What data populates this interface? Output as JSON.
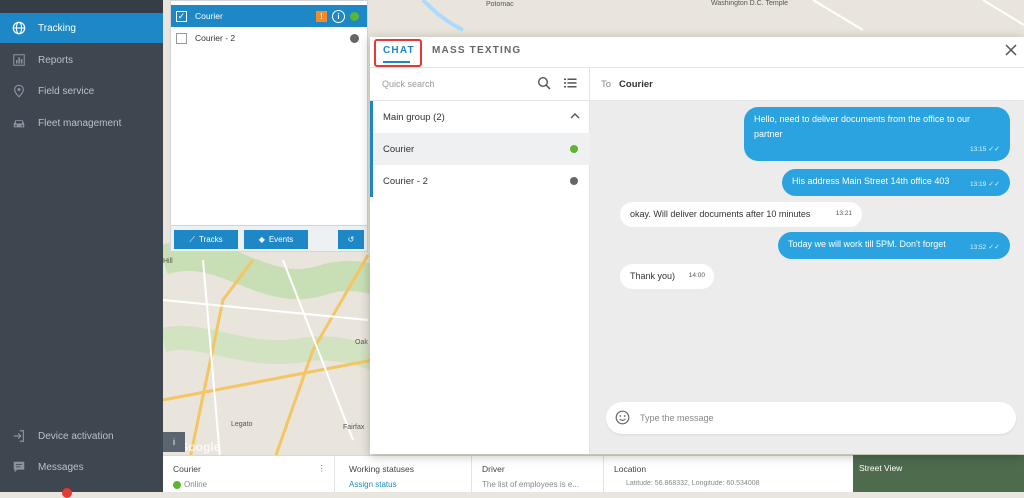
{
  "nav": {
    "items": [
      {
        "label": "Tracking",
        "icon": "globe-icon"
      },
      {
        "label": "Reports",
        "icon": "bar-chart-icon"
      },
      {
        "label": "Field service",
        "icon": "location-pin-icon"
      },
      {
        "label": "Fleet management",
        "icon": "car-icon"
      }
    ],
    "bottom_items": [
      {
        "label": "Device activation",
        "icon": "login-icon"
      },
      {
        "label": "Messages",
        "icon": "chat-bubble-icon"
      }
    ]
  },
  "units": {
    "rows": [
      {
        "name": "Courier",
        "status_color": "#5ab72e",
        "checked": true
      },
      {
        "name": "Courier - 2",
        "status_color": "#666666",
        "checked": false
      }
    ],
    "tracks_label": "Tracks",
    "events_label": "Events"
  },
  "bottombar": {
    "unit_name": "Courier",
    "unit_status": "Online",
    "working_statuses_label": "Working statuses",
    "assign_status_link": "Assign status",
    "driver_label": "Driver",
    "driver_value": "The list of employees is e...",
    "location_label": "Location",
    "location_value": "Latitude: 56.868332, Longitude: 60.534008",
    "street_view_label": "Street View",
    "info_btn": "i"
  },
  "map": {
    "labels": [
      "Potomac",
      "Washington D.C. Temple",
      "Hill",
      "Legato",
      "Fairfax",
      "Oak"
    ]
  },
  "chat": {
    "tabs": {
      "chat": "CHAT",
      "mass_texting": "MASS TEXTING"
    },
    "search_placeholder": "Quick search",
    "group_label": "Main group (2)",
    "contacts": [
      {
        "name": "Courier",
        "status_color": "#5ab72e"
      },
      {
        "name": "Courier - 2",
        "status_color": "#666666"
      }
    ],
    "to_label": "To",
    "to_name": "Courier",
    "messages": [
      {
        "direction": "out",
        "text_line1": "Hello, need to deliver documents from the office to our",
        "text_line2": "partner",
        "time": "13:15"
      },
      {
        "direction": "out",
        "text": "His address Main Street 14th office 403",
        "time": "13:19"
      },
      {
        "direction": "in",
        "text": "okay. Will deliver documents after 10 minutes",
        "time": "13:21"
      },
      {
        "direction": "out",
        "text": "Today we will work till 5PM. Don't forget",
        "time": "13:52"
      },
      {
        "direction": "in",
        "text": "Thank you)",
        "time": "14:00"
      }
    ],
    "input_placeholder": "Type the message"
  },
  "colors": {
    "accent": "#1e88c7",
    "bubble_out": "#2aa3e0",
    "highlight": "#e53935",
    "nav_bg": "#3e4650"
  }
}
